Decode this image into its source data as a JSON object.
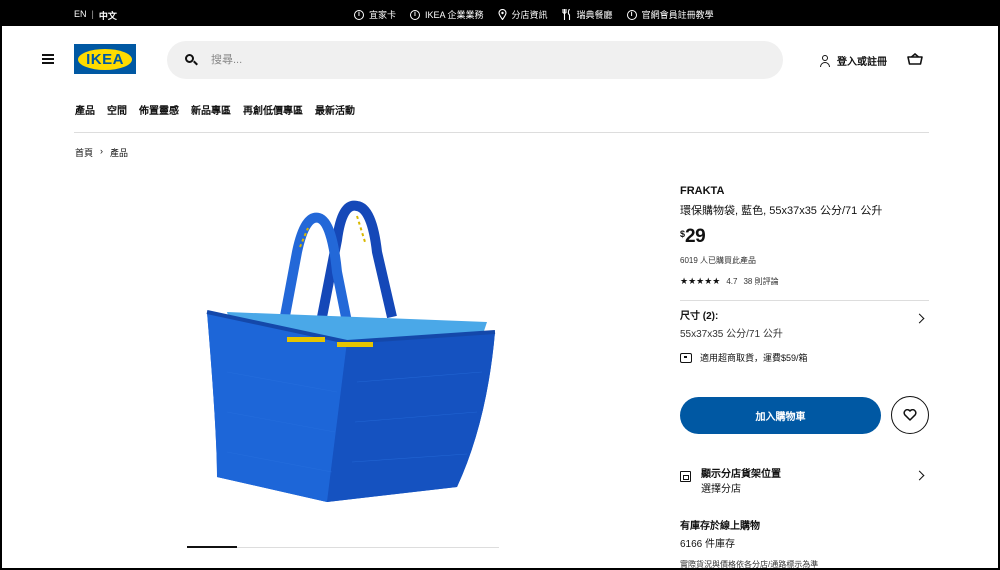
{
  "topbar": {
    "lang_en": "EN",
    "lang_zh": "中文",
    "links": [
      "宜家卡",
      "IKEA 企業業務",
      "分店資訊",
      "瑞典餐廳",
      "官網會員註冊教學"
    ]
  },
  "header": {
    "logo_text": "IKEA",
    "search_placeholder": "搜尋...",
    "login_label": "登入或註冊"
  },
  "nav": {
    "items": [
      "產品",
      "空間",
      "佈置靈感",
      "新品專區",
      "再創低價專區",
      "最新活動"
    ]
  },
  "breadcrumb": {
    "home": "首頁",
    "separator": "›",
    "current": "產品"
  },
  "product": {
    "name": "FRAKTA",
    "description": "環保購物袋, 藍色, 55x37x35 公分/71 公升",
    "currency": "$",
    "price": "29",
    "bought_text": "6019 人已購買此產品",
    "stars": "★★★★★",
    "rating": "4.7",
    "reviews": "38 則評論",
    "size_label": "尺寸 (2):",
    "size_value": "55x37x35 公分/71 公升",
    "pickup_text": "適用超商取貨，運費$59/箱",
    "add_to_cart": "加入購物車",
    "store_title": "顯示分店貨架位置",
    "store_sub": "選擇分店",
    "stock_title": "有庫存於線上購物",
    "stock_value": "6166 件庫存",
    "stock_note": "實際貨況與價格依各分店/通路標示為準"
  },
  "colors": {
    "ikea_blue": "#0058a3",
    "ikea_yellow": "#ffdb00",
    "bag_blue": "#1a5fd0"
  }
}
